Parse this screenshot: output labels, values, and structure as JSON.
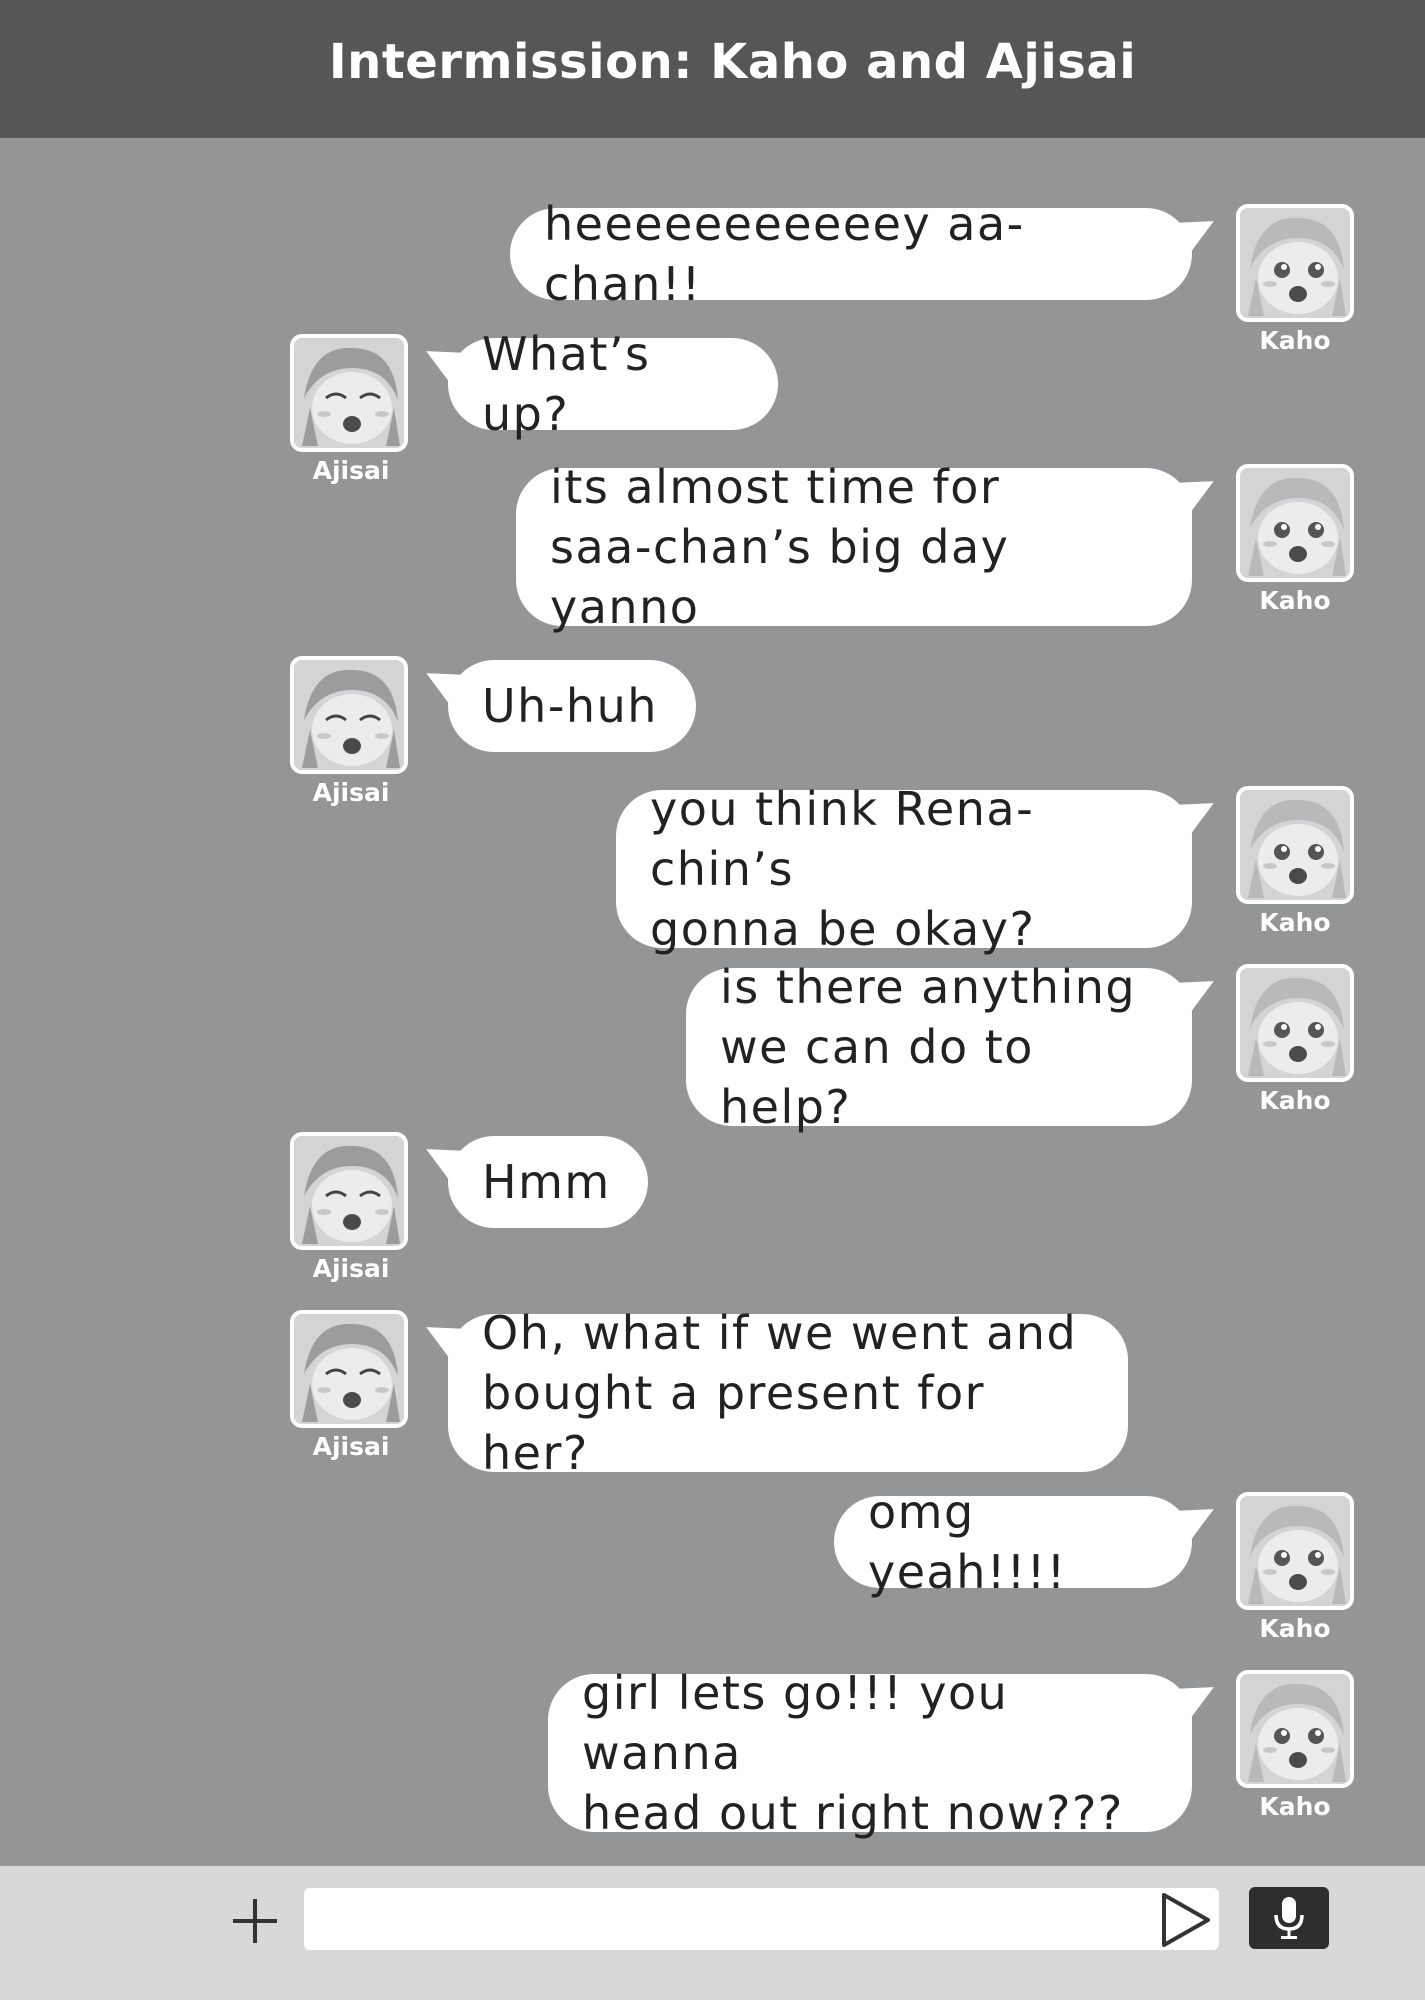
{
  "header": {
    "title": "Intermission: Kaho and Ajisai"
  },
  "messages": [
    {
      "sender": "Kaho",
      "side": "right",
      "text": "heeeeeeeeeeey aa-chan!!"
    },
    {
      "sender": "Ajisai",
      "side": "left",
      "text": "What’s up?"
    },
    {
      "sender": "Kaho",
      "side": "right",
      "text": "its almost time for\nsaa-chan’s big day yanno"
    },
    {
      "sender": "Ajisai",
      "side": "left",
      "text": "Uh-huh"
    },
    {
      "sender": "Kaho",
      "side": "right",
      "text": "you think Rena-chin’s\ngonna be okay?"
    },
    {
      "sender": "Kaho",
      "side": "right",
      "text": "is there anything\nwe can do to help?"
    },
    {
      "sender": "Ajisai",
      "side": "left",
      "text": "Hmm"
    },
    {
      "sender": "Ajisai",
      "side": "left",
      "text": "Oh, what if we went and\nbought a present for her?"
    },
    {
      "sender": "Kaho",
      "side": "right",
      "text": "omg yeah!!!!"
    },
    {
      "sender": "Kaho",
      "side": "right",
      "text": "girl lets go!!! you wanna\nhead out right now???"
    }
  ],
  "input": {
    "value": "",
    "placeholder": ""
  },
  "icons": {
    "add": "plus-icon",
    "send": "send-icon",
    "mic": "microphone-icon"
  },
  "colors": {
    "header_bg": "#555658",
    "chat_bg": "#939597",
    "bubble": "#ffffff",
    "footer_bg": "#d7d8da",
    "mic_bg": "#2e2e30"
  }
}
